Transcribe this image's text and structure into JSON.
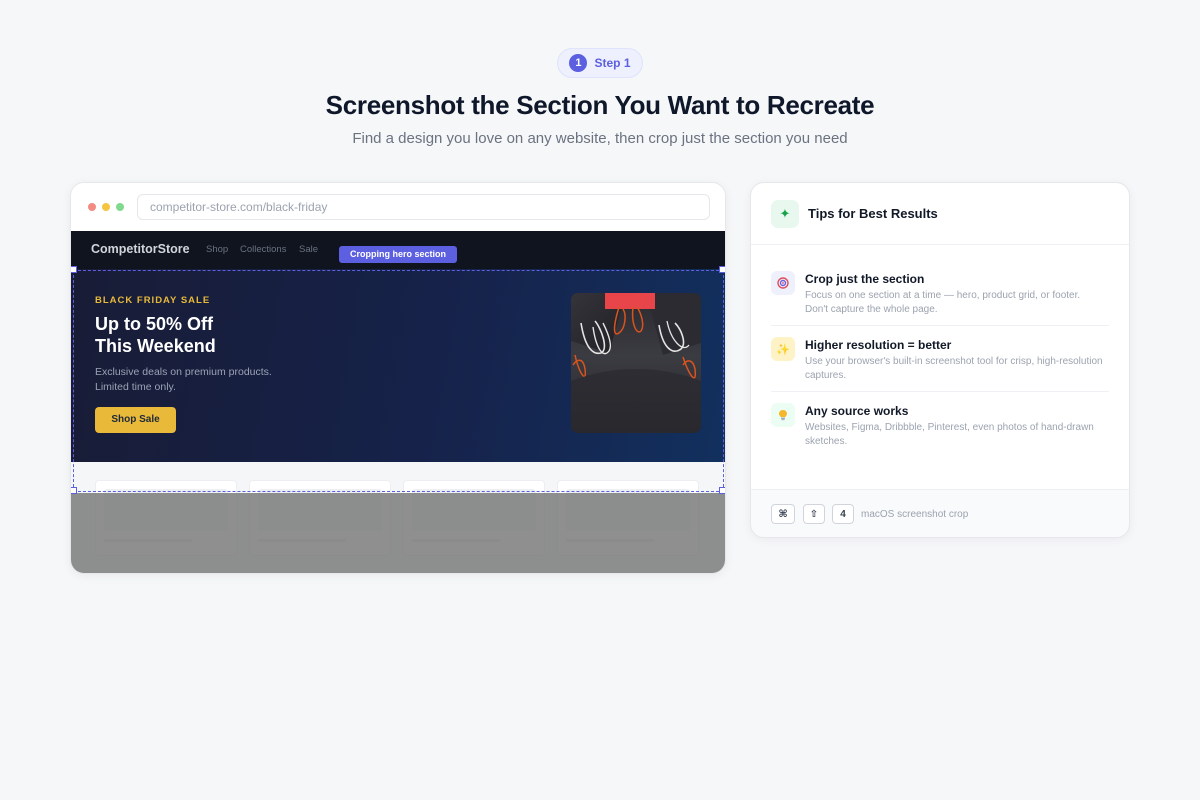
{
  "header": {
    "step_number": "1",
    "step_label": "Step 1",
    "title": "Screenshot the Section You Want to Recreate",
    "subtitle": "Find a design you love on any website, then crop just the section you need"
  },
  "browser": {
    "url": "competitor-store.com/black-friday",
    "site": {
      "logo": "CompetitorStore",
      "nav": [
        "Shop",
        "Collections",
        "Sale"
      ]
    },
    "crop_badge": "Cropping hero section",
    "hero": {
      "eyebrow": "BLACK FRIDAY SALE",
      "title_line1": "Up to 50% Off",
      "title_line2": "This Weekend",
      "desc_line1": "Exclusive deals on premium products.",
      "desc_line2": "Limited time only.",
      "button": "Shop Sale"
    }
  },
  "tips": {
    "title": "Tips for Best Results",
    "items": [
      {
        "icon": "target-icon",
        "title": "Crop just the section",
        "desc": "Focus on one section at a time — hero, product grid, or footer. Don't capture the whole page."
      },
      {
        "icon": "sparkles-icon",
        "title": "Higher resolution = better",
        "desc": "Use your browser's built-in screenshot tool for crisp, high-resolution captures."
      },
      {
        "icon": "lightbulb-icon",
        "title": "Any source works",
        "desc": "Websites, Figma, Dribbble, Pinterest, even photos of hand-drawn sketches."
      }
    ],
    "shortcut": {
      "keys": [
        "⌘",
        "⇧",
        "4"
      ],
      "label": "macOS screenshot crop"
    }
  },
  "colors": {
    "accent": "#5b5fe0",
    "hero_gold": "#e9b93a",
    "hero_bg": "#16224a",
    "page_bg": "#f6f7f9"
  }
}
